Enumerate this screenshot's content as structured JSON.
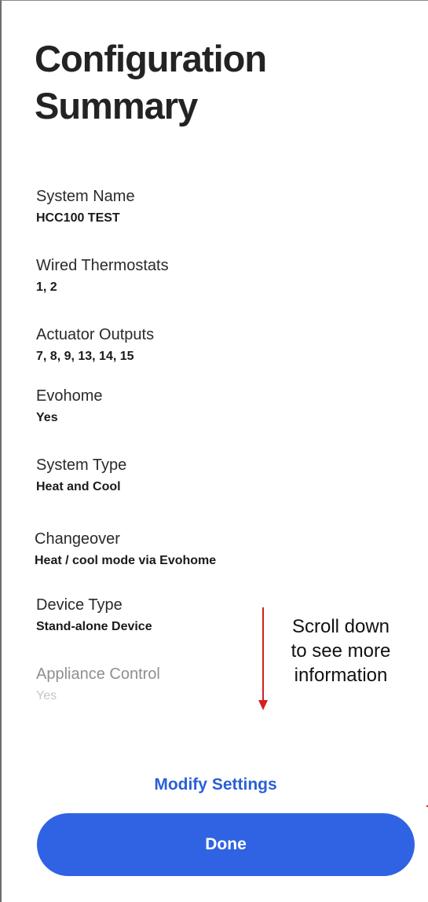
{
  "page": {
    "title_line1": "Configuration",
    "title_line2": "Summary"
  },
  "summary": {
    "fields": [
      {
        "label": "System Name",
        "value": "HCC100 TEST"
      },
      {
        "label": "Wired Thermostats",
        "value": "1, 2"
      },
      {
        "label": "Actuator Outputs",
        "value": "7, 8, 9, 13, 14, 15"
      },
      {
        "label": "Evohome",
        "value": "Yes"
      },
      {
        "label": "System Type",
        "value": "Heat and Cool"
      },
      {
        "label": "Changeover",
        "value": "Heat / cool mode via Evohome"
      },
      {
        "label": "Device Type",
        "value": "Stand-alone Device"
      },
      {
        "label": "Appliance Control",
        "value": "Yes"
      }
    ]
  },
  "annotation": {
    "line1": "Scroll down",
    "line2": "to see more",
    "line3": "information",
    "arrow_color": "#d32020"
  },
  "actions": {
    "modify_label": "Modify Settings",
    "done_label": "Done"
  },
  "colors": {
    "accent": "#2f63e3",
    "link": "#2a5fd8"
  }
}
